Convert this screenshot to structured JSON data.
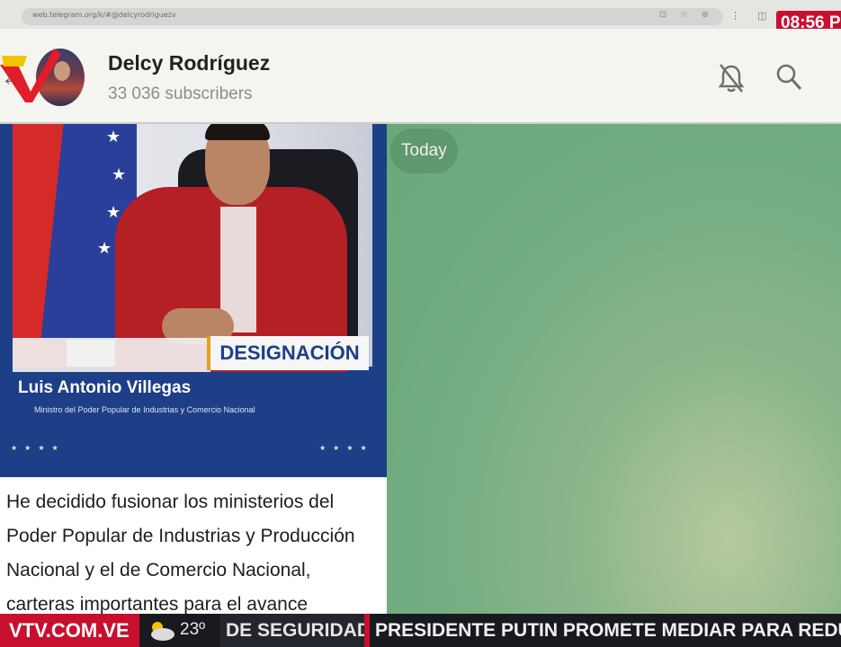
{
  "browser": {
    "url": "web.telegram.org/k/#@delcyrodriguezv"
  },
  "tv_overlay": {
    "clock": "08:56 P",
    "logo": "VTV.COM.VE",
    "temperature": "23º",
    "ticker_segments": [
      "DE SEGURIDAD",
      "PRESIDENTE PUTIN PROMETE MEDIAR PARA REDUCIR T"
    ]
  },
  "channel": {
    "name": "Delcy Rodríguez",
    "subscribers": "33 036 subscribers"
  },
  "header_icons": [
    "back-arrow-icon",
    "bell-off-icon",
    "search-icon"
  ],
  "post": {
    "banner_label": "DESIGNACIÓN",
    "person_name": "Luis Antonio Villegas",
    "person_title": "Ministro del Poder Popular de Industrias y Comercio Nacional",
    "text_lines": [
      "He decidido fusionar los ministerios del",
      "Poder Popular de Industrias y Producción",
      "Nacional y el de Comercio Nacional,",
      "carteras importantes para el avance"
    ]
  },
  "chat": {
    "date_separator": "Today"
  },
  "colors": {
    "tv_red": "#c8102e",
    "banner_blue": "#1d3f87",
    "chat_green": "#74ad82"
  }
}
